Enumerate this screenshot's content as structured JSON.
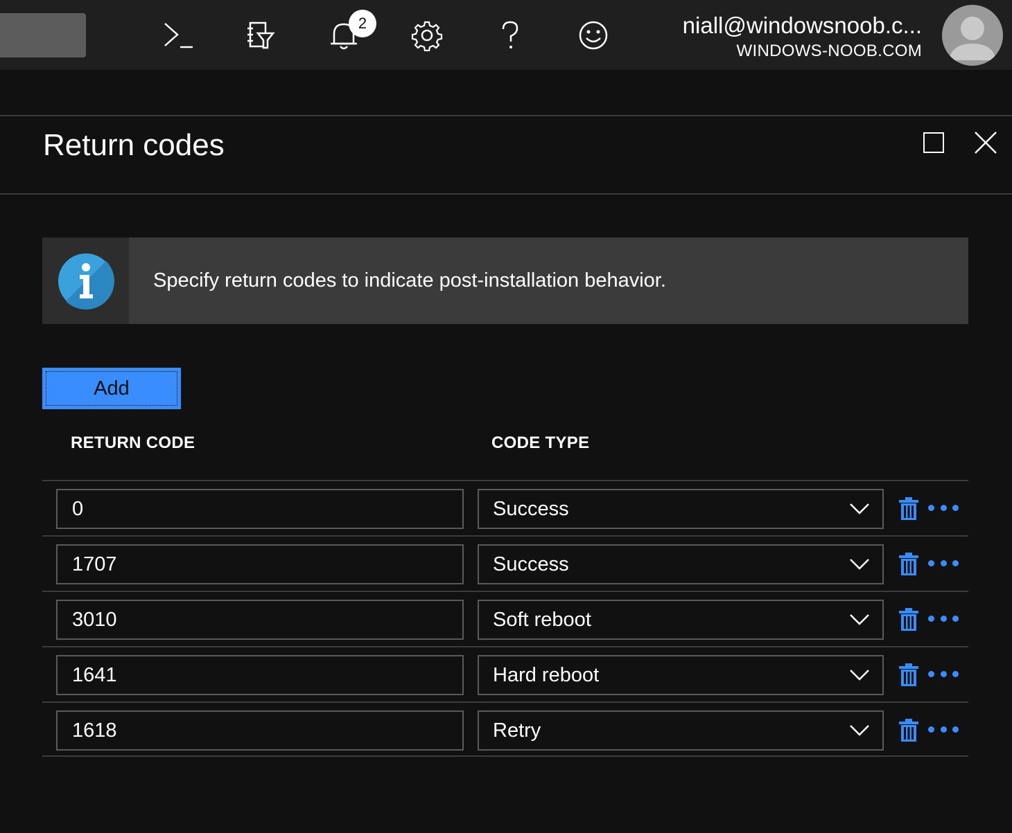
{
  "topbar": {
    "icons": [
      "cloud-shell-icon",
      "directory-filter-icon",
      "notifications-icon",
      "settings-icon",
      "help-icon",
      "feedback-icon"
    ],
    "notification_count": "2",
    "account_email": "niall@windowsnoob.c...",
    "account_directory": "WINDOWS-NOOB.COM"
  },
  "blade": {
    "title": "Return codes"
  },
  "info_banner": {
    "text": "Specify return codes to indicate post-installation behavior."
  },
  "add_label": "Add",
  "columns": {
    "return_code": "RETURN CODE",
    "code_type": "CODE TYPE"
  },
  "rows": [
    {
      "code": "0",
      "type": "Success"
    },
    {
      "code": "1707",
      "type": "Success"
    },
    {
      "code": "3010",
      "type": "Soft reboot"
    },
    {
      "code": "1641",
      "type": "Hard reboot"
    },
    {
      "code": "1618",
      "type": "Retry"
    }
  ],
  "colors": {
    "accent": "#3a8dff",
    "background": "#111111",
    "topbar": "#1f1f1f",
    "banner": "#3b3b3b"
  }
}
